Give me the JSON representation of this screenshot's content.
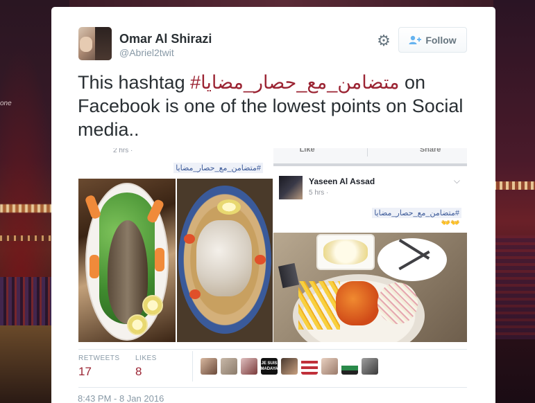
{
  "backdrop": {
    "left_text": "one"
  },
  "tweet": {
    "author_name": "Omar Al Shirazi",
    "author_handle": "@Abriel2twit",
    "follow_label": "Follow",
    "text_before": "This hashtag ",
    "hashtag": "#متضامن_مع_حصار_مضايا",
    "text_after": "  on Facebook is one of the lowest points on Social media..",
    "timestamp": "8:43 PM - 8 Jan 2016"
  },
  "media": {
    "left_post": {
      "time": "2 hrs · ",
      "hashtag": "#متضامن_مع_حصار_مضايا"
    },
    "right_post": {
      "like_label": "Like",
      "share_label": "Share",
      "author": "Yaseen Al Assad",
      "time": "5 hrs · ",
      "hashtag": "#متضامن_مع_حصار_مضايا",
      "emoji": "👐👐"
    }
  },
  "stats": {
    "retweets_label": "RETWEETS",
    "retweets_count": "17",
    "likes_label": "LIKES",
    "likes_count": "8",
    "liker_badge_text": "JE SUIS MADAYA"
  },
  "icons": {
    "gear": "gear-icon",
    "follow": "add-user-icon",
    "chevron": "chevron-down-icon"
  },
  "colors": {
    "hashtag": "#9b2433",
    "count": "#9b2433",
    "muted": "#8899a6",
    "text": "#292f33"
  }
}
